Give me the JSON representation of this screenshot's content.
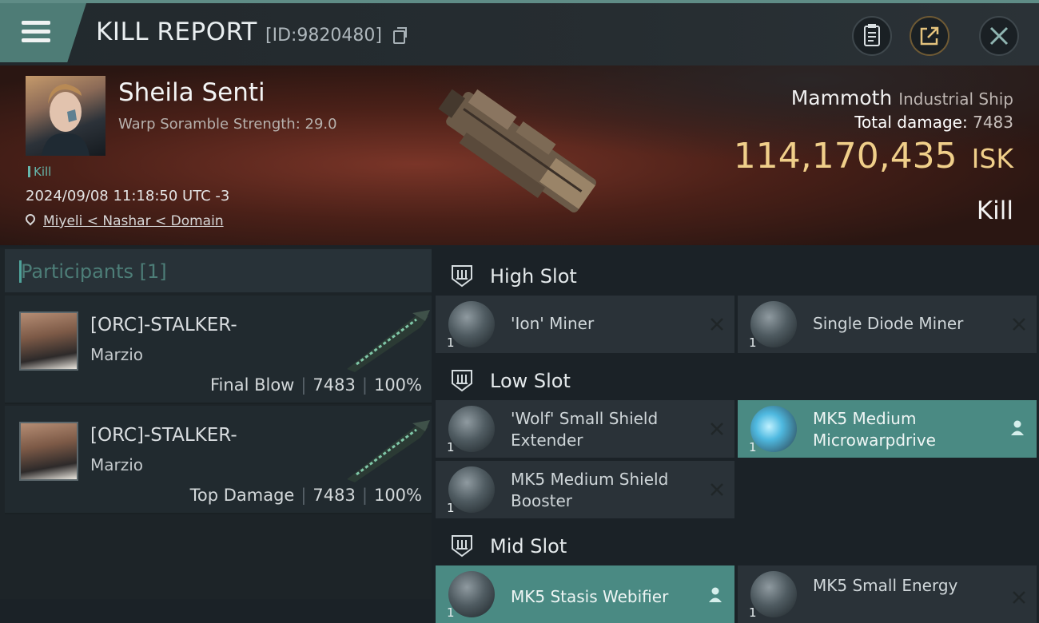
{
  "header": {
    "title": "KILL REPORT",
    "kill_id": "[ID:9820480]"
  },
  "victim": {
    "name": "Sheila Senti",
    "warp_scramble": "Warp Soramble Strength: 29.0",
    "tag": "Kill",
    "datetime": "2024/09/08 11:18:50 UTC -3",
    "location": "Miyeli < Nashar < Domain",
    "ship_name": "Mammoth",
    "ship_class": "Industrial Ship",
    "damage_label": "Total damage:",
    "damage_value": "7483",
    "isk_value": "114,170,435",
    "isk_unit": "ISK",
    "result": "Kill"
  },
  "participants": {
    "title": "Participants [1]",
    "rows": [
      {
        "name": "[ORC]-STALKER-",
        "sub": "Marzio",
        "label": "Final Blow",
        "damage": "7483",
        "percent": "100%"
      },
      {
        "name": "[ORC]-STALKER-",
        "sub": "Marzio",
        "label": "Top Damage",
        "damage": "7483",
        "percent": "100%"
      }
    ]
  },
  "slots": {
    "high": {
      "title": "High Slot",
      "items": [
        {
          "qty": "1",
          "name1": "'Ion' Miner",
          "name2": ""
        },
        {
          "qty": "1",
          "name1": "Single Diode Miner",
          "name2": ""
        }
      ]
    },
    "low": {
      "title": "Low Slot",
      "items": [
        {
          "qty": "1",
          "name1": "'Wolf' Small Shield",
          "name2": "Extender"
        },
        {
          "qty": "1",
          "name1": "MK5 Medium",
          "name2": "Microwarpdrive"
        },
        {
          "qty": "1",
          "name1": "MK5 Medium Shield",
          "name2": "Booster"
        }
      ]
    },
    "mid": {
      "title": "Mid Slot",
      "items": [
        {
          "qty": "1",
          "name1": "MK5 Stasis Webifier",
          "name2": ""
        },
        {
          "qty": "1",
          "name1": "MK5 Small Energy",
          "name2": ""
        }
      ]
    }
  },
  "colors": {
    "accent": "#4e7c76",
    "isk": "#f0cf8a",
    "highlight_item": "#4a8a83"
  }
}
